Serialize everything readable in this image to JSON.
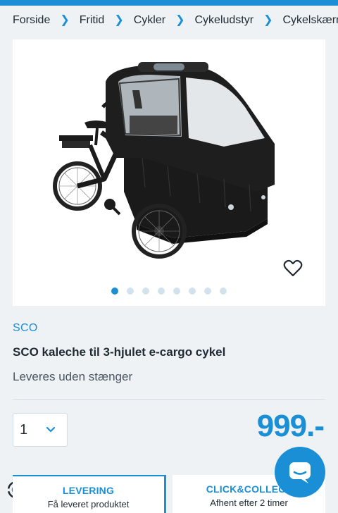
{
  "breadcrumb": {
    "items": [
      "Forside",
      "Fritid",
      "Cykler",
      "Cykeludstyr",
      "Cykelskærme"
    ],
    "separator": ">"
  },
  "product": {
    "brand": "SCO",
    "title": "SCO kaleche til 3-hjulet e-cargo cykel",
    "subtitle": "Leveres uden stænger",
    "price": "999.-",
    "image_icon": "cargo-bike-image",
    "favorite_icon": "heart-icon"
  },
  "gallery": {
    "count": 8,
    "active_index": 0
  },
  "quantity": {
    "value": "1"
  },
  "delivery": {
    "levering": {
      "title": "LEVERING",
      "subtitle": "Få leveret produktet"
    },
    "click_collect": {
      "title": "CLICK&COLLECT",
      "subtitle": "Afhent efter 2 timer"
    }
  },
  "colors": {
    "accent": "#1a8fd6",
    "text": "#1f2a33",
    "background": "#eef2f5"
  }
}
